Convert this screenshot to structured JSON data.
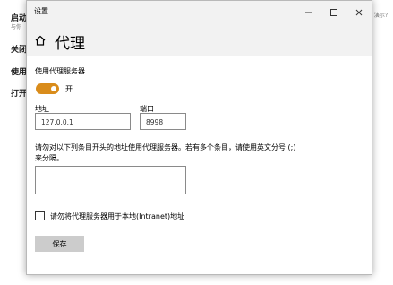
{
  "background_window": {
    "items": [
      "启动",
      "关闭",
      "使用",
      "打开"
    ],
    "sub_text": "与你",
    "right_text": "演示?"
  },
  "dialog": {
    "title": "设置",
    "page_title": "代理",
    "use_proxy_label": "使用代理服务器",
    "toggle_state_label": "开",
    "toggle_on": true,
    "address_label": "地址",
    "address_value": "127.0.0.1",
    "port_label": "端口",
    "port_value": "8998",
    "exceptions_description": "请勿对以下列条目开头的地址使用代理服务器。若有多个条目，请使用英文分号 (;) 来分隔。",
    "exceptions_value": "",
    "bypass_local_label": "请勿将代理服务器用于本地(Intranet)地址",
    "bypass_local_checked": false,
    "save_label": "保存",
    "accent_color": "#d98c1b"
  }
}
